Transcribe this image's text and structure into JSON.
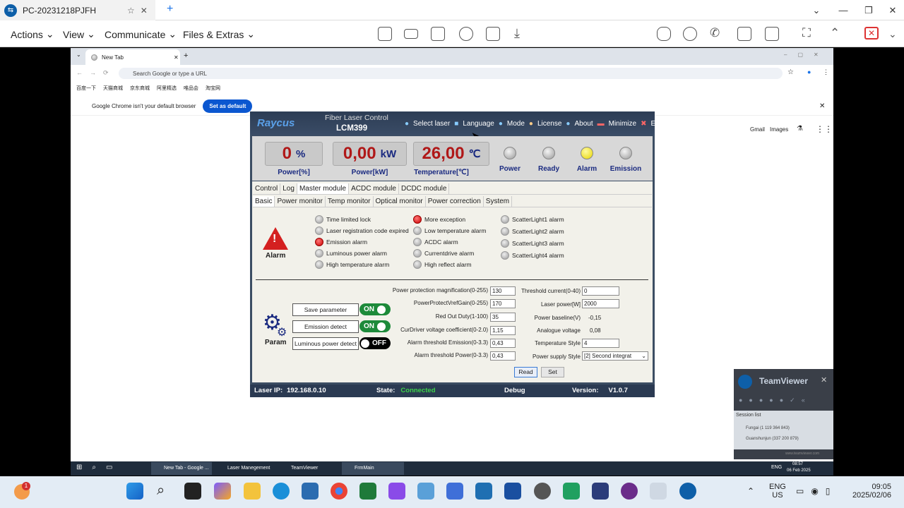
{
  "teamviewer": {
    "tab_title": "PC-20231218PJFH",
    "menu": [
      "Actions",
      "View",
      "Communicate",
      "Files & Extras"
    ]
  },
  "chrome": {
    "tab_title": "New Tab",
    "address_placeholder": "Search Google or type a URL",
    "bookmarks": [
      "百度一下",
      "天猫商城",
      "京东商城",
      "阿里精选",
      "唯品会",
      "淘宝网"
    ],
    "infobar_text": "Google Chrome isn't your default browser",
    "set_default_label": "Set as default",
    "links": [
      "Gmail",
      "Images"
    ]
  },
  "app": {
    "brand": "Raycus",
    "title": "Fiber Laser Control",
    "model": "LCM399",
    "menu": [
      "Select laser",
      "Language",
      "Mode",
      "License",
      "About",
      "Minimize",
      "Exit"
    ],
    "meters": [
      {
        "value": "0",
        "unit": "%",
        "label": "Power[%]"
      },
      {
        "value": "0,00",
        "unit": "kW",
        "label": "Power[kW]"
      },
      {
        "value": "26,00",
        "unit": "℃",
        "label": "Temperature[℃]"
      }
    ],
    "lamps": [
      {
        "label": "Power",
        "color": "#bbbbbb"
      },
      {
        "label": "Ready",
        "color": "#bbbbbb"
      },
      {
        "label": "Alarm",
        "color": "#f2e32a"
      },
      {
        "label": "Emission",
        "color": "#bbbbbb"
      }
    ],
    "tabs1": [
      "Control",
      "Log",
      "Master module",
      "ACDC module",
      "DCDC module"
    ],
    "tabs2": [
      "Basic",
      "Power monitor",
      "Temp monitor",
      "Optical monitor",
      "Power correction",
      "System"
    ],
    "alarm_label": "Alarm",
    "alarms_col1": [
      {
        "text": "Time limited lock",
        "active": false
      },
      {
        "text": "Laser registration code expired",
        "active": false
      },
      {
        "text": "Emission alarm",
        "active": true
      },
      {
        "text": "Luminous power alarm",
        "active": false
      },
      {
        "text": "High temperature alarm",
        "active": false
      }
    ],
    "alarms_col2": [
      {
        "text": "More exception",
        "active": true
      },
      {
        "text": "Low temperature alarm",
        "active": false
      },
      {
        "text": "ACDC alarm",
        "active": false
      },
      {
        "text": "Currentdrive alarm",
        "active": false
      },
      {
        "text": "High reflect alarm",
        "active": false
      }
    ],
    "alarms_col3": [
      {
        "text": "ScatterLight1 alarm",
        "active": false
      },
      {
        "text": "ScatterLight2 alarm",
        "active": false
      },
      {
        "text": "ScatterLight3 alarm",
        "active": false
      },
      {
        "text": "ScatterLight4 alarm",
        "active": false
      }
    ],
    "param_label": "Param",
    "toggles": [
      {
        "label": "Save parameter",
        "state": "ON"
      },
      {
        "label": "Emission detect",
        "state": "ON"
      },
      {
        "label": "Luminous power detect",
        "state": "OFF"
      }
    ],
    "fields_left": [
      {
        "label": "Power protection magnification(0-255)",
        "value": "130"
      },
      {
        "label": "PowerProtectVrefGain(0-255)",
        "value": "170"
      },
      {
        "label": "Red Out Duty(1-100)",
        "value": "35"
      },
      {
        "label": "CurDriver voltage coefficient(0-2.0)",
        "value": "1,15"
      },
      {
        "label": "Alarm threshold Emission(0-3.3)",
        "value": "0,43"
      },
      {
        "label": "Alarm threshold Power(0-3.3)",
        "value": "0,43"
      }
    ],
    "fields_right": [
      {
        "label": "Threshold current(0-40)",
        "value": "0",
        "type": "input"
      },
      {
        "label": "Laser power[W]",
        "value": "2000",
        "type": "input"
      },
      {
        "label": "Power baseline(V)",
        "value": "-0,15",
        "type": "text"
      },
      {
        "label": "Analogue voltage",
        "value": "0,08",
        "type": "text"
      },
      {
        "label": "Temperature Style",
        "value": "4",
        "type": "input"
      },
      {
        "label": "Power supply Style",
        "value": "[2] Second integrat",
        "type": "select"
      }
    ],
    "read_label": "Read",
    "set_label": "Set",
    "status": {
      "ip_label": "Laser IP:",
      "ip": "192.168.0.10",
      "state_label": "State:",
      "state": "Connected",
      "debug": "Debug",
      "version_label": "Version:",
      "version": "V1.0.7"
    }
  },
  "tv_widget": {
    "title": "TeamViewer",
    "session_list": "Session list",
    "sessions": [
      "Fungai (1 119 364 843)",
      "Guanshunjun (337 200 879)"
    ],
    "footer": "www.teamviewer.com"
  },
  "remote_taskbar": {
    "apps": [
      "New Tab - Google ...",
      "Laser Manegement",
      "TeamViewer",
      "FrmMain"
    ],
    "lang": "ENG",
    "time": "08:57",
    "date": "06 Feb 2025"
  },
  "local_taskbar": {
    "badge": "1",
    "lang": "ENG",
    "region": "US",
    "time": "09:05",
    "date": "2025/02/06"
  }
}
